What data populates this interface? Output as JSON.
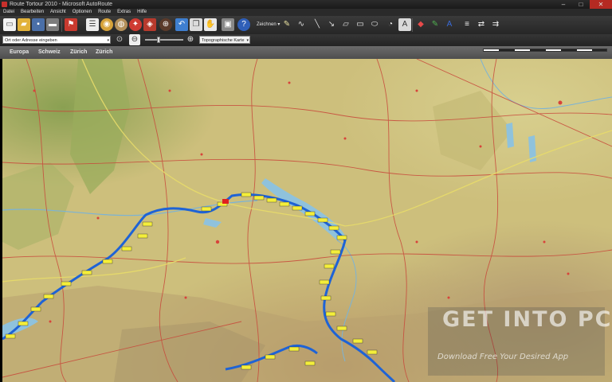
{
  "window": {
    "title": "Route Tortour 2010 - Microsoft AutoRoute"
  },
  "menu": {
    "items": [
      "Datei",
      "Bearbeiten",
      "Ansicht",
      "Optionen",
      "Route",
      "Extras",
      "Hilfe"
    ]
  },
  "toolbar": {
    "zeichnen_label": "Zeichnen"
  },
  "address": {
    "placeholder": "Ort oder Adresse eingeben"
  },
  "map_style": {
    "selected": "Topographische Karte"
  },
  "breadcrumb": [
    "Europa",
    "Schweiz",
    "Zürich",
    "Zürich"
  ],
  "watermark": {
    "logo": "GET INTO PC",
    "tagline": "Download Free Your Desired App"
  },
  "colors": {
    "route": "#1e63d6",
    "dark_ui": "#2a2a2a",
    "close_button": "#b52a22"
  }
}
